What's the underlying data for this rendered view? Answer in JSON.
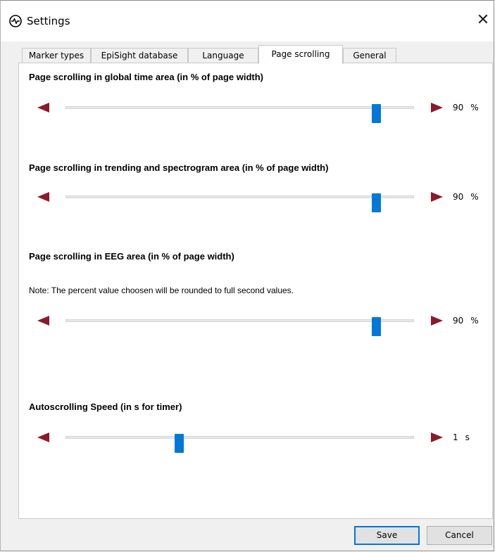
{
  "window": {
    "title": "Settings",
    "close_glyph": "✕"
  },
  "tabs": [
    {
      "label": "Marker types",
      "active": false
    },
    {
      "label": "EpiSight database",
      "active": false
    },
    {
      "label": "Language",
      "active": false
    },
    {
      "label": "Page scrolling",
      "active": true
    },
    {
      "label": "General",
      "active": false
    }
  ],
  "sections": [
    {
      "heading": "Page scrolling in global time area (in % of page width)",
      "value": "90",
      "unit": "%",
      "slider_fraction": 0.9
    },
    {
      "heading": "Page scrolling in trending and spectrogram area (in % of page width)",
      "value": "90",
      "unit": "%",
      "slider_fraction": 0.9
    },
    {
      "heading": "Page scrolling in EEG area (in % of page width)",
      "note": "Note: The percent value choosen will be rounded to full second values.",
      "value": "90",
      "unit": "%",
      "slider_fraction": 0.9
    },
    {
      "heading": "Autoscrolling Speed (in s for timer)",
      "value": "1",
      "unit": "s",
      "slider_fraction": 0.32
    }
  ],
  "buttons": {
    "save": "Save",
    "cancel": "Cancel"
  },
  "colors": {
    "accent": "#0078d7",
    "arrow": "#8b1a2b"
  },
  "icons": {
    "app": "pulse-circle-icon",
    "close": "close-icon",
    "left": "arrow-left-icon",
    "right": "arrow-right-icon"
  }
}
